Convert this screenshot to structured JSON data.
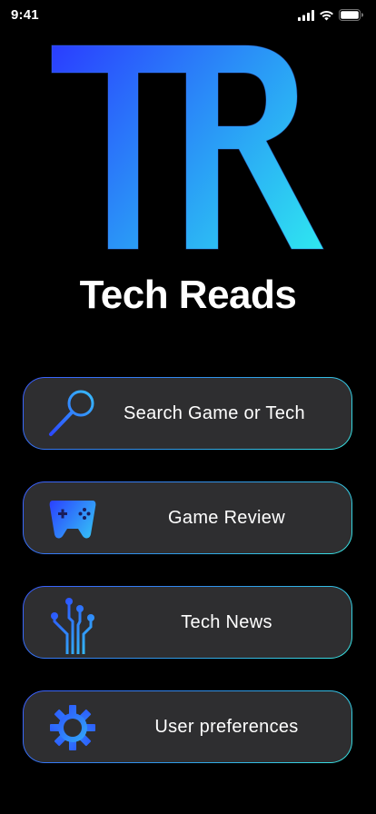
{
  "status_bar": {
    "time": "9:41",
    "icons": [
      "signal-icon",
      "wifi-icon",
      "battery-icon"
    ]
  },
  "logo": {
    "letters": "TR",
    "gradient": [
      "#2a3cff",
      "#2fe9f0"
    ]
  },
  "app": {
    "title": "Tech Reads"
  },
  "menu": {
    "items": [
      {
        "label": "Search Game or Tech",
        "icon": "magnifier-icon"
      },
      {
        "label": "Game Review",
        "icon": "gamepad-icon"
      },
      {
        "label": "Tech News",
        "icon": "circuit-icon"
      },
      {
        "label": "User preferences",
        "icon": "gear-icon"
      }
    ]
  },
  "colors": {
    "background": "#000000",
    "button_fill": "#2e2e30",
    "accent_blue": "#2a3cff",
    "accent_cyan": "#2fe9f0"
  }
}
